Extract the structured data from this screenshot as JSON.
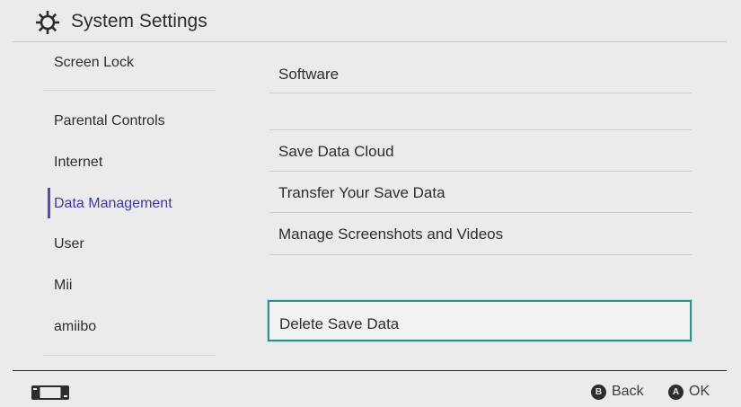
{
  "header": {
    "title": "System Settings",
    "icon": "gear-icon"
  },
  "sidebar": {
    "items": [
      {
        "label": "Screen Lock"
      },
      {
        "label": "Parental Controls"
      },
      {
        "label": "Internet"
      },
      {
        "label": "Data Management"
      },
      {
        "label": "User"
      },
      {
        "label": "Mii"
      },
      {
        "label": "amiibo"
      }
    ],
    "active_index": 3
  },
  "menu": {
    "items": [
      {
        "label": "Software"
      },
      {
        "label": "Save Data Cloud"
      },
      {
        "label": "Transfer Your Save Data"
      },
      {
        "label": "Manage Screenshots and Videos"
      },
      {
        "label": "Delete Save Data"
      }
    ],
    "selected_index": 4
  },
  "footer": {
    "back": {
      "glyph": "B",
      "label": "Back"
    },
    "ok": {
      "glyph": "A",
      "label": "OK"
    },
    "controller_icon": "controller-icon"
  },
  "colors": {
    "accent": "#2f8f8d",
    "active": "#3a3aa8",
    "background": "#ebebeb"
  }
}
